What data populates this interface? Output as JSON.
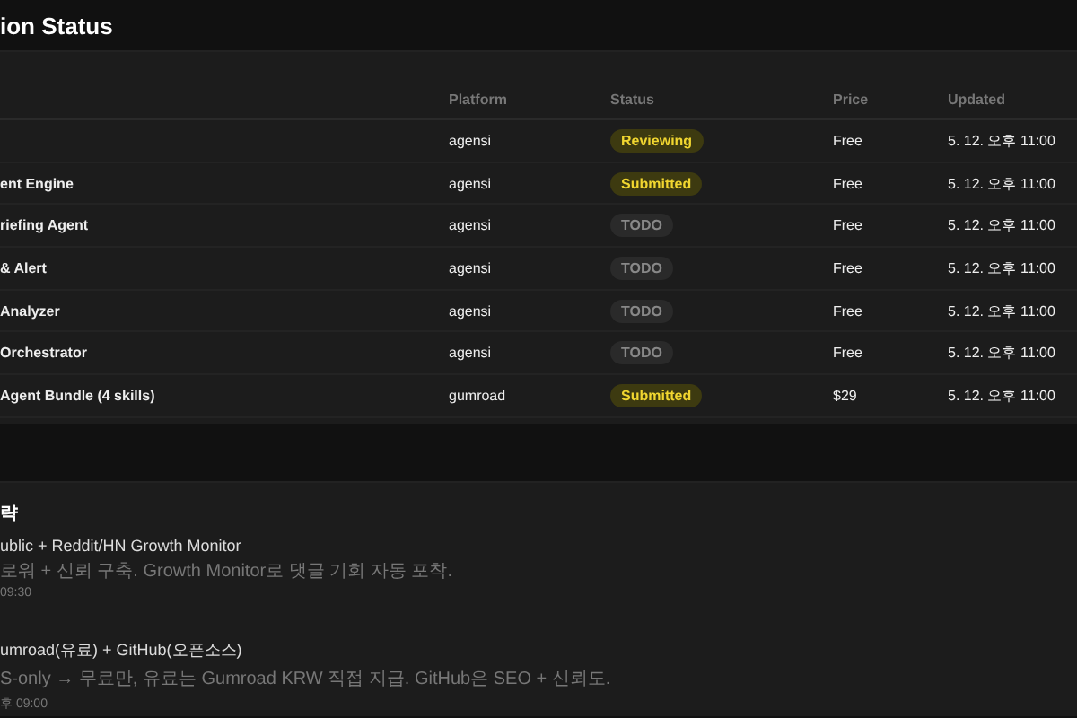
{
  "header": {
    "title": "ion Status"
  },
  "table": {
    "columns": [
      "Platform",
      "Status",
      "Price",
      "Updated"
    ],
    "rows": [
      {
        "name": "",
        "platform": "agensi",
        "status": {
          "label": "Reviewing",
          "kind": "active"
        },
        "price": "Free",
        "updated": "5. 12. 오후 11:00"
      },
      {
        "name": "ent Engine",
        "platform": "agensi",
        "status": {
          "label": "Submitted",
          "kind": "active"
        },
        "price": "Free",
        "updated": "5. 12. 오후 11:00"
      },
      {
        "name": "riefing Agent",
        "platform": "agensi",
        "status": {
          "label": "TODO",
          "kind": "todo"
        },
        "price": "Free",
        "updated": "5. 12. 오후 11:00"
      },
      {
        "name": "& Alert",
        "platform": "agensi",
        "status": {
          "label": "TODO",
          "kind": "todo"
        },
        "price": "Free",
        "updated": "5. 12. 오후 11:00"
      },
      {
        "name": "Analyzer",
        "platform": "agensi",
        "status": {
          "label": "TODO",
          "kind": "todo"
        },
        "price": "Free",
        "updated": "5. 12. 오후 11:00"
      },
      {
        "name": "Orchestrator",
        "platform": "agensi",
        "status": {
          "label": "TODO",
          "kind": "todo"
        },
        "price": "Free",
        "updated": "5. 12. 오후 11:00"
      },
      {
        "name": "Agent Bundle (4 skills)",
        "platform": "gumroad",
        "status": {
          "label": "Submitted",
          "kind": "active"
        },
        "price": "$29",
        "updated": "5. 12. 오후 11:00"
      }
    ]
  },
  "strategy": {
    "heading": "략",
    "items": [
      {
        "title": "ublic + Reddit/HN Growth Monitor",
        "description": "로워 + 신뢰 구축. Growth Monitor로 댓글 기회 자동 포착.",
        "time": "09:30"
      },
      {
        "title": "umroad(유료) + GitHub(오픈소스)",
        "description": "S-only → 무료만, 유료는 Gumroad KRW 직접 지급. GitHub은 SEO + 신뢰도.",
        "time": "후 09:00"
      }
    ]
  }
}
